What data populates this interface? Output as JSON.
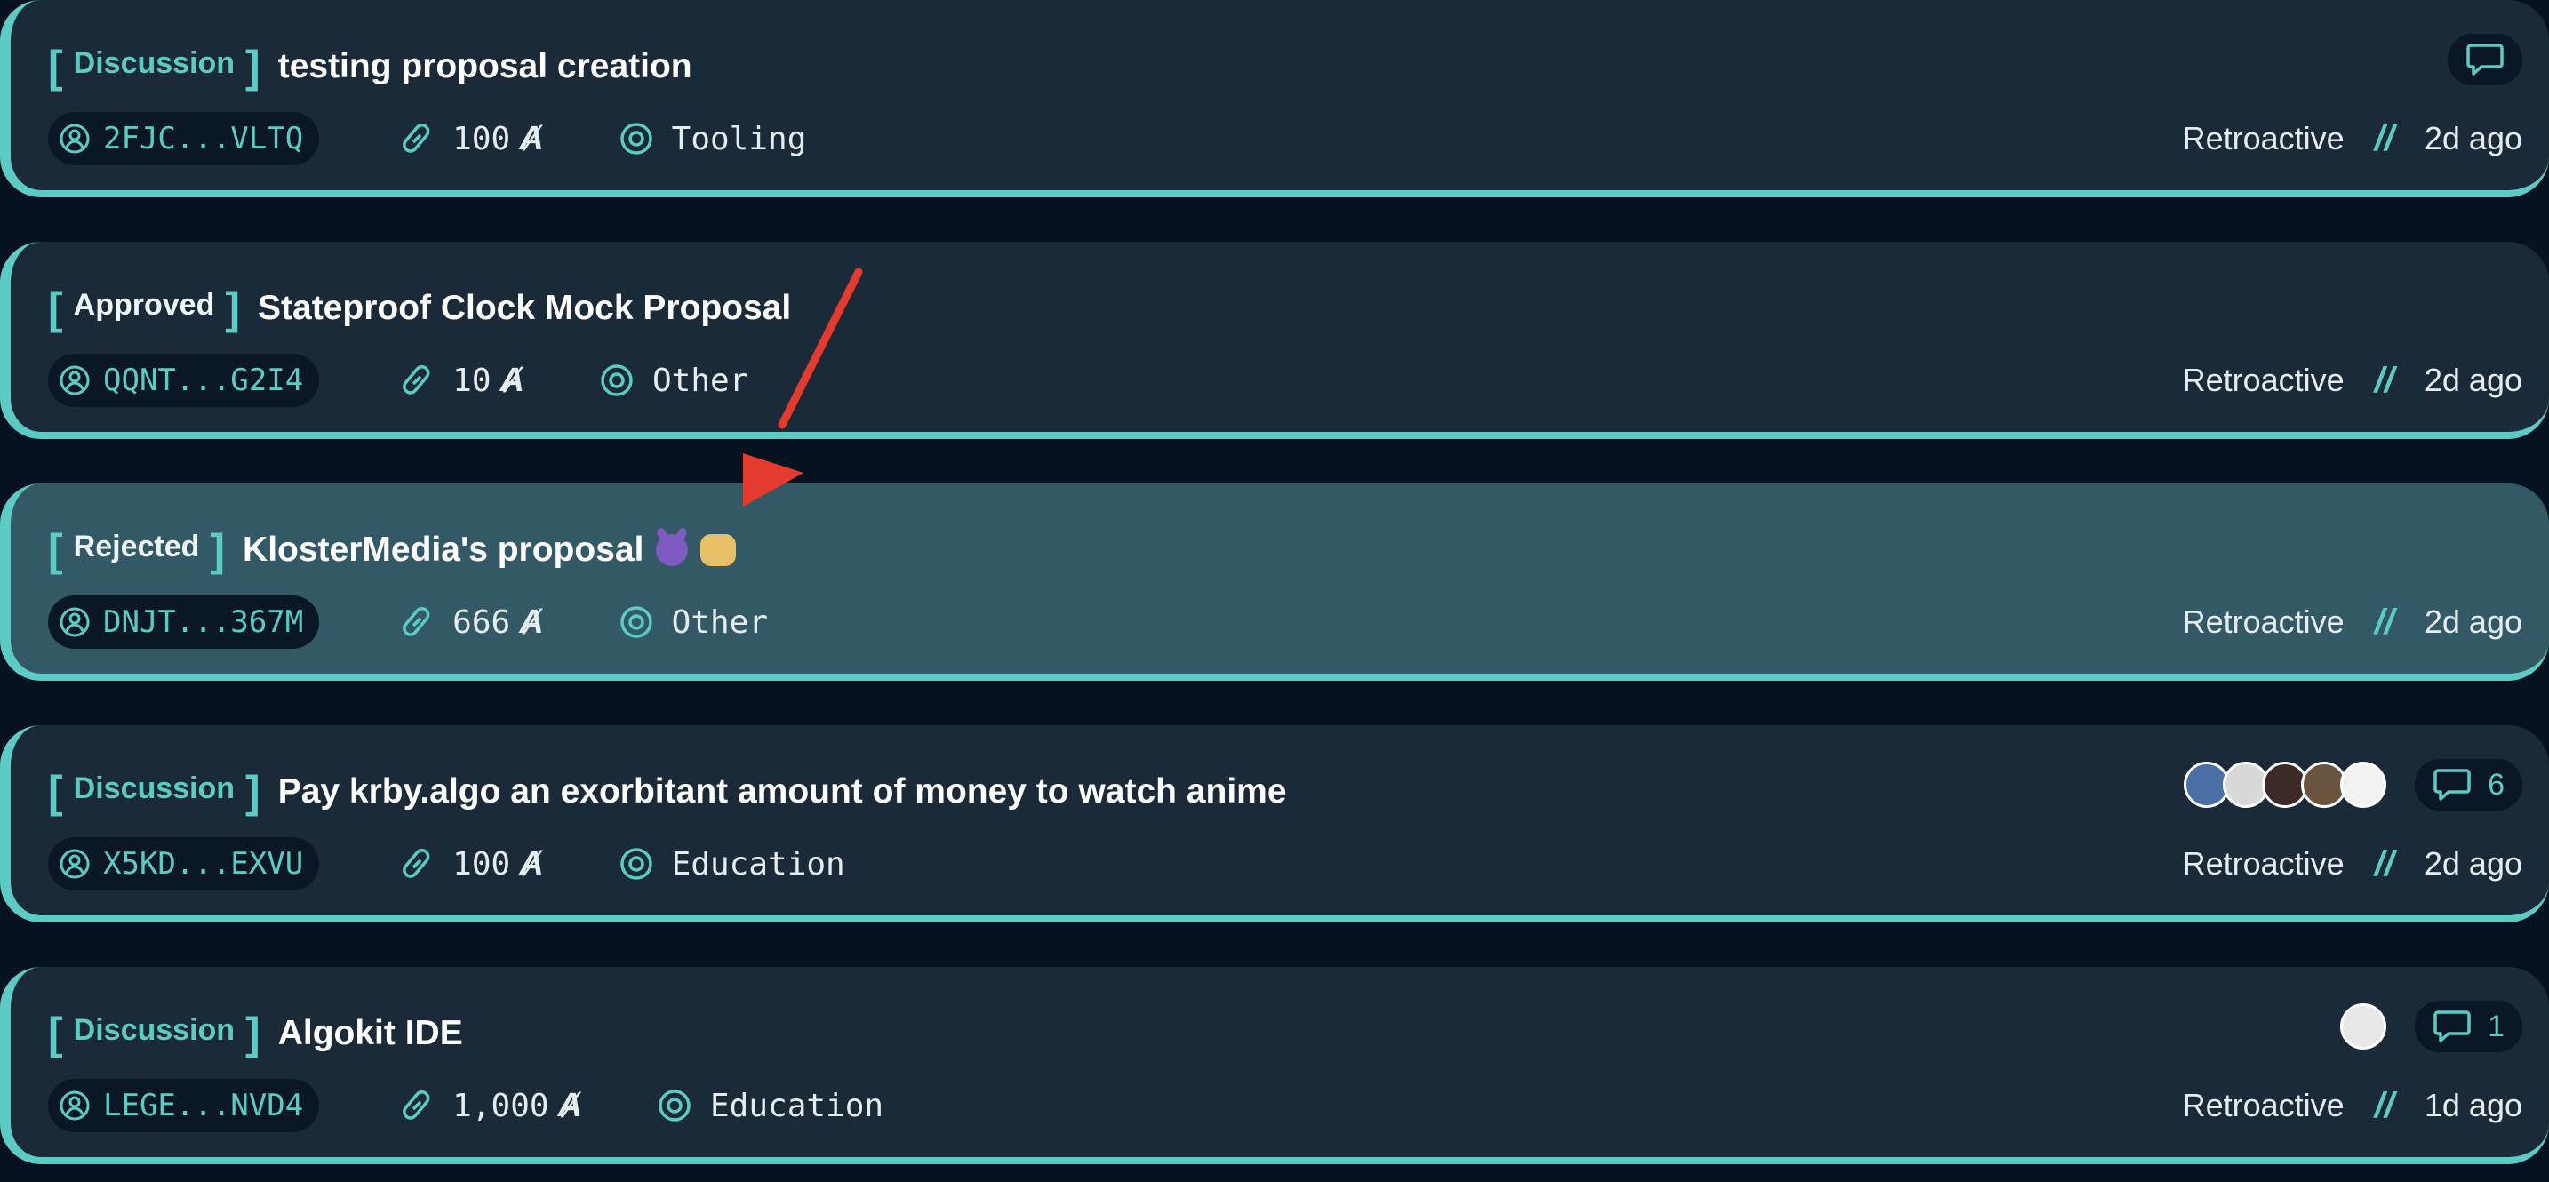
{
  "colors": {
    "accent": "#5ccbc4",
    "card_bg": "#1b2a38",
    "card_bg_highlight": "#335966",
    "page_bg": "#061220",
    "annotation_arrow": "#e53b2f"
  },
  "proposals": [
    {
      "status": "Discussion",
      "title": "testing proposal creation",
      "address": "2FJC...VLTQ",
      "amount": "100",
      "category": "Tooling",
      "type": "Retroactive",
      "age": "2d ago",
      "comments": null,
      "avatars": []
    },
    {
      "status": "Approved",
      "title": "Stateproof Clock Mock Proposal",
      "address": "QQNT...G2I4",
      "amount": "10",
      "category": "Other",
      "type": "Retroactive",
      "age": "2d ago",
      "comments": null,
      "avatars": []
    },
    {
      "status": "Rejected",
      "title": "KlosterMedia's proposal",
      "title_emoji": [
        "smiling-devil-emoji",
        "fist-emoji"
      ],
      "address": "DNJT...367M",
      "amount": "666",
      "category": "Other",
      "type": "Retroactive",
      "age": "2d ago",
      "comments": null,
      "avatars": []
    },
    {
      "status": "Discussion",
      "title": "Pay krby.algo an exorbitant amount of money to watch anime",
      "address": "X5KD...EXVU",
      "amount": "100",
      "category": "Education",
      "type": "Retroactive",
      "age": "2d ago",
      "comments": "6",
      "avatars": [
        "#4a6fa5",
        "#d8d8d8",
        "#3b2a25",
        "#6a5440",
        "#f2f2f2"
      ]
    },
    {
      "status": "Discussion",
      "title": "Algokit IDE",
      "address": "LEGE...NVD4",
      "amount": "1,000",
      "category": "Education",
      "type": "Retroactive",
      "age": "1d ago",
      "comments": "1",
      "avatars": [
        "#e8e8e8"
      ]
    }
  ],
  "icons": {
    "author": "user-circle-icon",
    "amount": "paperclip-icon",
    "category": "target-icon",
    "comments": "chat-bubble-icon",
    "currency": "algo-symbol"
  },
  "separator": "//",
  "algo_symbol": "Ⱥ"
}
